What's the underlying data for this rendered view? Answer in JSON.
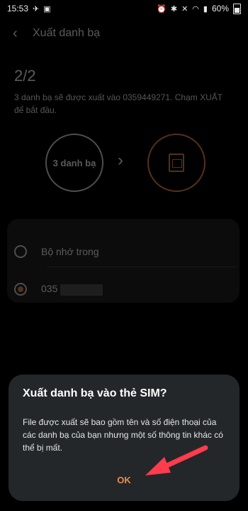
{
  "status": {
    "time": "15:53",
    "battery": "60%"
  },
  "appbar": {
    "title": "Xuất danh bạ"
  },
  "step": "2/2",
  "info": "3 danh bạ sẽ được xuất vào 0359449271. Chạm XUẤT để bắt đầu.",
  "circle_left": "3 danh bạ",
  "options": [
    {
      "label": "Bộ nhớ trong",
      "selected": false
    },
    {
      "label": "035",
      "selected": true
    }
  ],
  "dialog": {
    "title": "Xuất danh bạ vào thẻ SIM?",
    "message": "File được xuất sẽ bao gồm tên và số điện thoại của các danh bạ của bạn nhưng một số thông tin khác có thể bị mất.",
    "ok": "OK"
  },
  "colors": {
    "accent": "#f08a4b",
    "annotation_arrow": "#ff3b4e",
    "dialog_bg": "#232729"
  }
}
